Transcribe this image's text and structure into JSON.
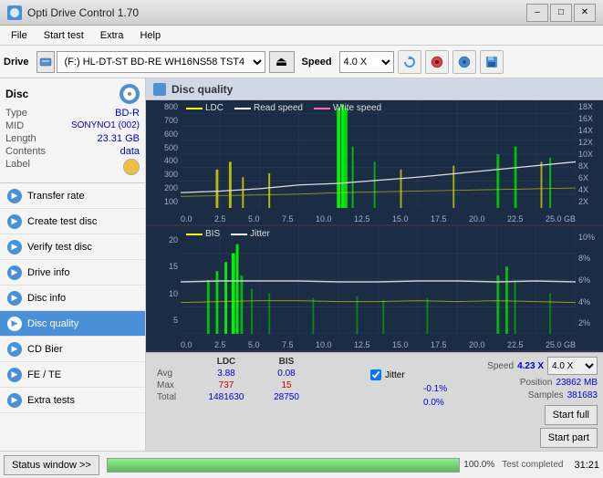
{
  "titleBar": {
    "title": "Opti Drive Control 1.70",
    "minimizeLabel": "–",
    "maximizeLabel": "□",
    "closeLabel": "✕"
  },
  "menuBar": {
    "items": [
      "File",
      "Start test",
      "Extra",
      "Help"
    ]
  },
  "toolbar": {
    "driveLabel": "Drive",
    "driveValue": "(F:) HL-DT-ST BD-RE  WH16NS58 TST4",
    "speedLabel": "Speed",
    "speedValue": "4.0 X"
  },
  "sidebar": {
    "discSection": {
      "header": "Disc",
      "typeLabel": "Type",
      "typeValue": "BD-R",
      "midLabel": "MID",
      "midValue": "SONYNO1 (002)",
      "lengthLabel": "Length",
      "lengthValue": "23.31 GB",
      "contentsLabel": "Contents",
      "contentsValue": "data",
      "labelLabel": "Label",
      "labelValue": ""
    },
    "items": [
      {
        "label": "Transfer rate",
        "icon": "▶",
        "iconColor": "si-blue",
        "active": false
      },
      {
        "label": "Create test disc",
        "icon": "▶",
        "iconColor": "si-blue",
        "active": false
      },
      {
        "label": "Verify test disc",
        "icon": "▶",
        "iconColor": "si-blue",
        "active": false
      },
      {
        "label": "Drive info",
        "icon": "▶",
        "iconColor": "si-blue",
        "active": false
      },
      {
        "label": "Disc info",
        "icon": "▶",
        "iconColor": "si-blue",
        "active": false
      },
      {
        "label": "Disc quality",
        "icon": "▶",
        "iconColor": "si-blue",
        "active": true
      },
      {
        "label": "CD Bier",
        "icon": "▶",
        "iconColor": "si-blue",
        "active": false
      },
      {
        "label": "FE / TE",
        "icon": "▶",
        "iconColor": "si-blue",
        "active": false
      },
      {
        "label": "Extra tests",
        "icon": "▶",
        "iconColor": "si-blue",
        "active": false
      }
    ]
  },
  "contentHeader": {
    "title": "Disc quality"
  },
  "chart1": {
    "legend": [
      {
        "label": "LDC",
        "color": "#ffff00"
      },
      {
        "label": "Read speed",
        "color": "#ffffff"
      },
      {
        "label": "Write speed",
        "color": "#ff69b4"
      }
    ],
    "yLeftLabels": [
      "800",
      "700",
      "600",
      "500",
      "400",
      "300",
      "200",
      "100"
    ],
    "yRightLabels": [
      "18X",
      "16X",
      "14X",
      "12X",
      "10X",
      "8X",
      "6X",
      "4X",
      "2X"
    ],
    "xLabels": [
      "0.0",
      "2.5",
      "5.0",
      "7.5",
      "10.0",
      "12.5",
      "15.0",
      "17.5",
      "20.0",
      "22.5",
      "25.0 GB"
    ]
  },
  "chart2": {
    "legend": [
      {
        "label": "BIS",
        "color": "#ffff00"
      },
      {
        "label": "Jitter",
        "color": "#ffffff"
      }
    ],
    "yLeftLabels": [
      "20",
      "15",
      "10",
      "5"
    ],
    "yRightLabels": [
      "10%",
      "8%",
      "6%",
      "4%",
      "2%"
    ],
    "xLabels": [
      "0.0",
      "2.5",
      "5.0",
      "7.5",
      "10.0",
      "12.5",
      "15.0",
      "17.5",
      "20.0",
      "22.5",
      "25.0 GB"
    ]
  },
  "stats": {
    "columns": [
      "LDC",
      "BIS",
      "",
      "Jitter"
    ],
    "rows": [
      {
        "label": "Avg",
        "ldc": "3.88",
        "bis": "0.08",
        "jitter": "-0.1%"
      },
      {
        "label": "Max",
        "ldc": "737",
        "bis": "15",
        "jitter": "0.0%"
      },
      {
        "label": "Total",
        "ldc": "1481630",
        "bis": "28750",
        "jitter": ""
      }
    ],
    "jitterChecked": true,
    "jitterLabel": "Jitter",
    "speedLabel": "Speed",
    "speedValue": "4.23 X",
    "speedSelectValue": "4.0 X",
    "positionLabel": "Position",
    "positionValue": "23862 MB",
    "samplesLabel": "Samples",
    "samplesValue": "381683",
    "startFullLabel": "Start full",
    "startPartLabel": "Start part"
  },
  "statusBar": {
    "statusBtnLabel": "Status window >>",
    "progressPercent": 100,
    "progressLabel": "100.0%",
    "timeLabel": "31:21",
    "completedLabel": "Test completed"
  },
  "colors": {
    "accent": "#4a90d9",
    "chartBg": "#1a2d45",
    "gridLine": "#2a4060",
    "ldc": "#c8c800",
    "bis": "#c8c800",
    "readSpeed": "#e0e0e0",
    "jitter": "#e0e0e0",
    "spikeGreen": "#00dd00",
    "spikeYellow": "#dddd00"
  }
}
